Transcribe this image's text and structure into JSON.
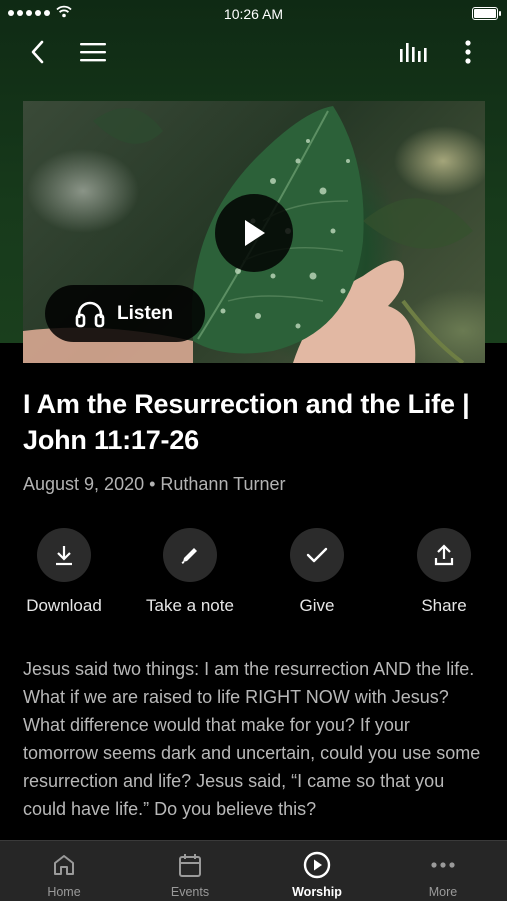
{
  "status_bar": {
    "time": "10:26 AM"
  },
  "nav": {
    "back_icon": "chevron-left-icon",
    "menu_icon": "hamburger-menu-icon",
    "audio_icon": "equalizer-icon",
    "more_icon": "more-vertical-icon"
  },
  "hero": {
    "listen_label": "Listen"
  },
  "sermon": {
    "title": "I Am the Resurrection and the Life | John 11:17-26",
    "meta": "August 9, 2020 • Ruthann Turner",
    "description": "Jesus said two things: I am the resurrection AND the life. What if we are raised to life RIGHT NOW with Jesus? What difference would that make for you? If your tomorrow seems dark and uncertain, could you use some resurrection and life? Jesus said, “I came so that you could have life.” Do you believe this?"
  },
  "actions": [
    {
      "label": "Download",
      "icon": "download-icon"
    },
    {
      "label": "Take a note",
      "icon": "pencil-icon"
    },
    {
      "label": "Give",
      "icon": "checkmark-icon"
    },
    {
      "label": "Share",
      "icon": "share-icon"
    }
  ],
  "tabs": [
    {
      "label": "Home",
      "icon": "home-icon"
    },
    {
      "label": "Events",
      "icon": "calendar-icon"
    },
    {
      "label": "Worship",
      "icon": "play-circle-icon",
      "active": true
    },
    {
      "label": "More",
      "icon": "more-horizontal-icon"
    }
  ],
  "colors": {
    "header_green": "#173a1b",
    "background": "#000000",
    "tab_bar": "#262626",
    "action_circle": "#2b2b2b"
  }
}
